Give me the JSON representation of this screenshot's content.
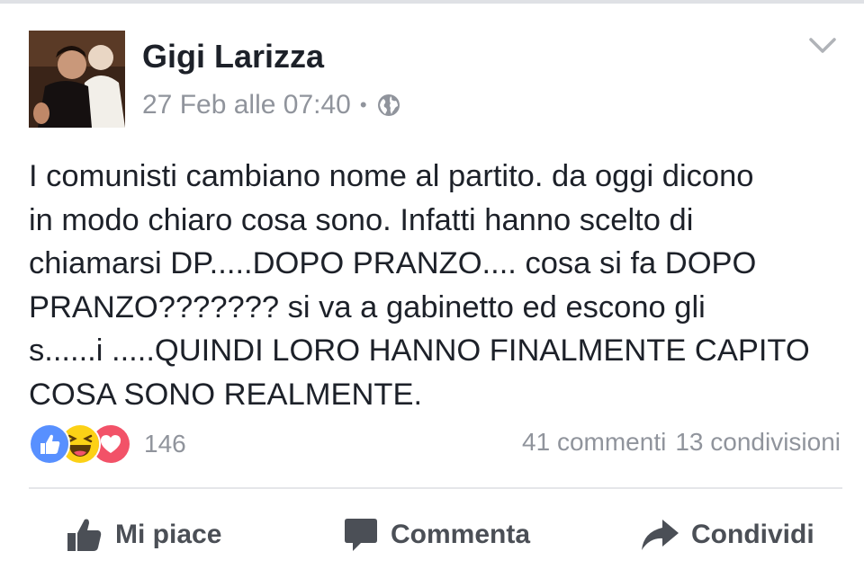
{
  "post": {
    "author": "Gigi Larizza",
    "timestamp": "27 Feb alle 07:40",
    "separator": "•",
    "privacy_icon": "globe-icon",
    "text": "I comunisti cambiano nome al partito. da oggi dicono\nin modo chiaro cosa sono. Infatti hanno scelto di\nchiamarsi DP.....DOPO PRANZO.... cosa si fa DOPO\nPRANZO??????? si va a gabinetto ed escono gli\ns......i .....QUINDI LORO HANNO FINALMENTE CAPITO\nCOSA SONO REALMENTE."
  },
  "reactions": {
    "icons": [
      "like-icon",
      "haha-icon",
      "love-icon"
    ],
    "count": "146"
  },
  "stats": {
    "comments": "41 commenti",
    "shares": "13 condivisioni"
  },
  "actions": {
    "like_label": "Mi piace",
    "comment_label": "Commenta",
    "share_label": "Condividi"
  },
  "colors": {
    "text": "#1d2129",
    "secondary": "#90949c",
    "action": "#4b4f56",
    "like_blue": "#5890ff",
    "love_red": "#f25268",
    "haha_yellow": "#fcd116"
  }
}
